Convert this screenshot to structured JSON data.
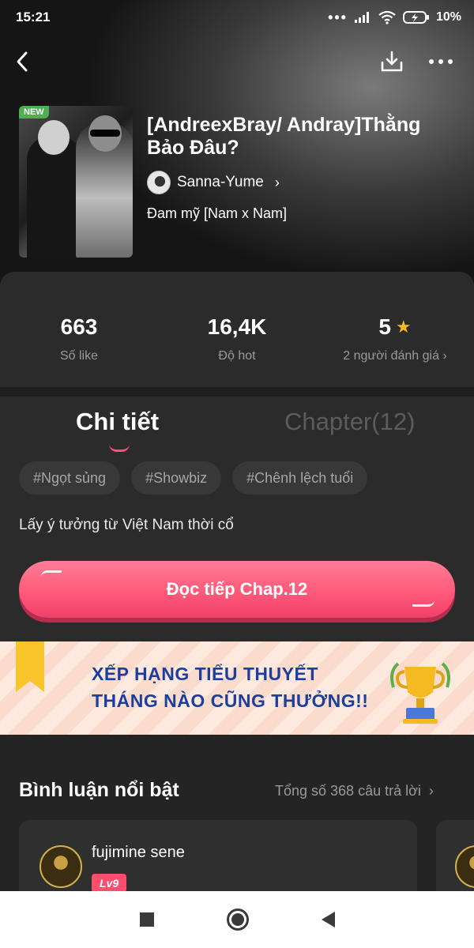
{
  "status_bar": {
    "time": "15:21",
    "signal": "•••",
    "battery": "10%"
  },
  "header": {
    "icons": [
      "back-icon",
      "download-icon",
      "more-icon"
    ]
  },
  "book": {
    "badge": "NEW",
    "title": "[AndreexBray/ Andray]Thằng Bảo Đâu?",
    "author": "Sanna-Yume",
    "author_chevron": "›",
    "genre": "Đam mỹ [Nam x Nam]"
  },
  "stats": {
    "likes_value": "663",
    "likes_label": "Số like",
    "hot_value": "16,4K",
    "hot_label": "Độ hot",
    "rating_value": "5",
    "rating_label": "2 người đánh giá ›"
  },
  "tabs": {
    "detail": "Chi tiết",
    "chapter": "Chapter(12)"
  },
  "tags": [
    "#Ngọt sủng",
    "#Showbiz",
    "#Chênh lệch tuổi"
  ],
  "summary": "Lấy ý tưởng từ Việt Nam thời cổ",
  "read_button": "Đọc tiếp Chap.12",
  "banner": {
    "line1": "XẾP HẠNG TIỂU THUYẾT",
    "line2": "THÁNG NÀO CŨNG THƯỞNG!!"
  },
  "comments": {
    "title": "Bình luận nổi bật",
    "total": "Tổng số 368 câu trả lời",
    "chevron": "›",
    "items": [
      {
        "user": "fujimine sene",
        "level": "Lv9"
      }
    ]
  },
  "colors": {
    "accent": "#ff5a7a",
    "star": "#f5b921",
    "banner_text": "#1c3f9e",
    "new_badge": "#4caf50"
  }
}
